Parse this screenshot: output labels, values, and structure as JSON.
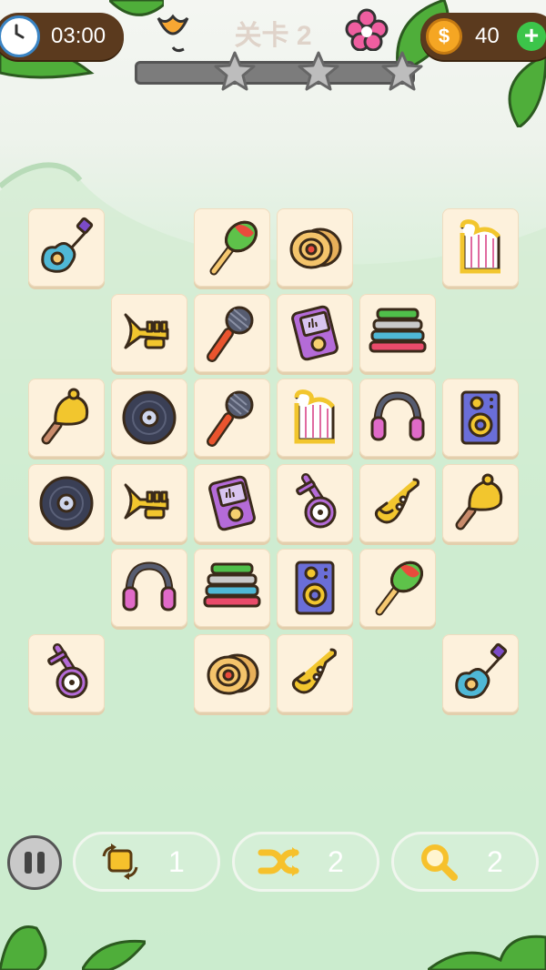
{
  "hud": {
    "timer": "03:00",
    "level": "关卡 2",
    "coins": "40",
    "plus_label": "+",
    "coin_symbol": "$",
    "stars_total": 3
  },
  "tiles": [
    {
      "row": 0,
      "col": 0,
      "icon": "ukulele-icon"
    },
    {
      "row": 0,
      "col": 2,
      "icon": "maracas-icon"
    },
    {
      "row": 0,
      "col": 3,
      "icon": "cymbal-icon"
    },
    {
      "row": 0,
      "col": 5,
      "icon": "harp-icon"
    },
    {
      "row": 1,
      "col": 1,
      "icon": "trumpet-icon"
    },
    {
      "row": 1,
      "col": 2,
      "icon": "microphone-icon"
    },
    {
      "row": 1,
      "col": 3,
      "icon": "music-player-icon"
    },
    {
      "row": 1,
      "col": 4,
      "icon": "xylophone-icon"
    },
    {
      "row": 2,
      "col": 0,
      "icon": "handbell-icon"
    },
    {
      "row": 2,
      "col": 1,
      "icon": "vinyl-record-icon"
    },
    {
      "row": 2,
      "col": 2,
      "icon": "microphone-icon"
    },
    {
      "row": 2,
      "col": 3,
      "icon": "harp-icon"
    },
    {
      "row": 2,
      "col": 4,
      "icon": "headphones-icon"
    },
    {
      "row": 2,
      "col": 5,
      "icon": "speaker-icon"
    },
    {
      "row": 3,
      "col": 0,
      "icon": "vinyl-record-icon"
    },
    {
      "row": 3,
      "col": 1,
      "icon": "trumpet-icon"
    },
    {
      "row": 3,
      "col": 2,
      "icon": "music-player-icon"
    },
    {
      "row": 3,
      "col": 3,
      "icon": "banjo-icon"
    },
    {
      "row": 3,
      "col": 4,
      "icon": "saxophone-icon"
    },
    {
      "row": 3,
      "col": 5,
      "icon": "handbell-icon"
    },
    {
      "row": 4,
      "col": 1,
      "icon": "headphones-icon"
    },
    {
      "row": 4,
      "col": 2,
      "icon": "xylophone-icon"
    },
    {
      "row": 4,
      "col": 3,
      "icon": "speaker-icon"
    },
    {
      "row": 4,
      "col": 4,
      "icon": "maracas-icon"
    },
    {
      "row": 5,
      "col": 0,
      "icon": "banjo-icon"
    },
    {
      "row": 5,
      "col": 2,
      "icon": "cymbal-icon"
    },
    {
      "row": 5,
      "col": 3,
      "icon": "saxophone-icon"
    },
    {
      "row": 5,
      "col": 5,
      "icon": "ukulele-icon"
    }
  ],
  "tools": [
    {
      "name": "undo",
      "icon": "undo-icon",
      "count": "1"
    },
    {
      "name": "shuffle",
      "icon": "shuffle-icon",
      "count": "2"
    },
    {
      "name": "hint",
      "icon": "search-icon",
      "count": "2"
    }
  ],
  "colors": {
    "hud_bg": "#5b3a1e",
    "tile_bg": "#fdf1dc",
    "accent_green": "#3cc54a",
    "coin": "#f5a623"
  }
}
